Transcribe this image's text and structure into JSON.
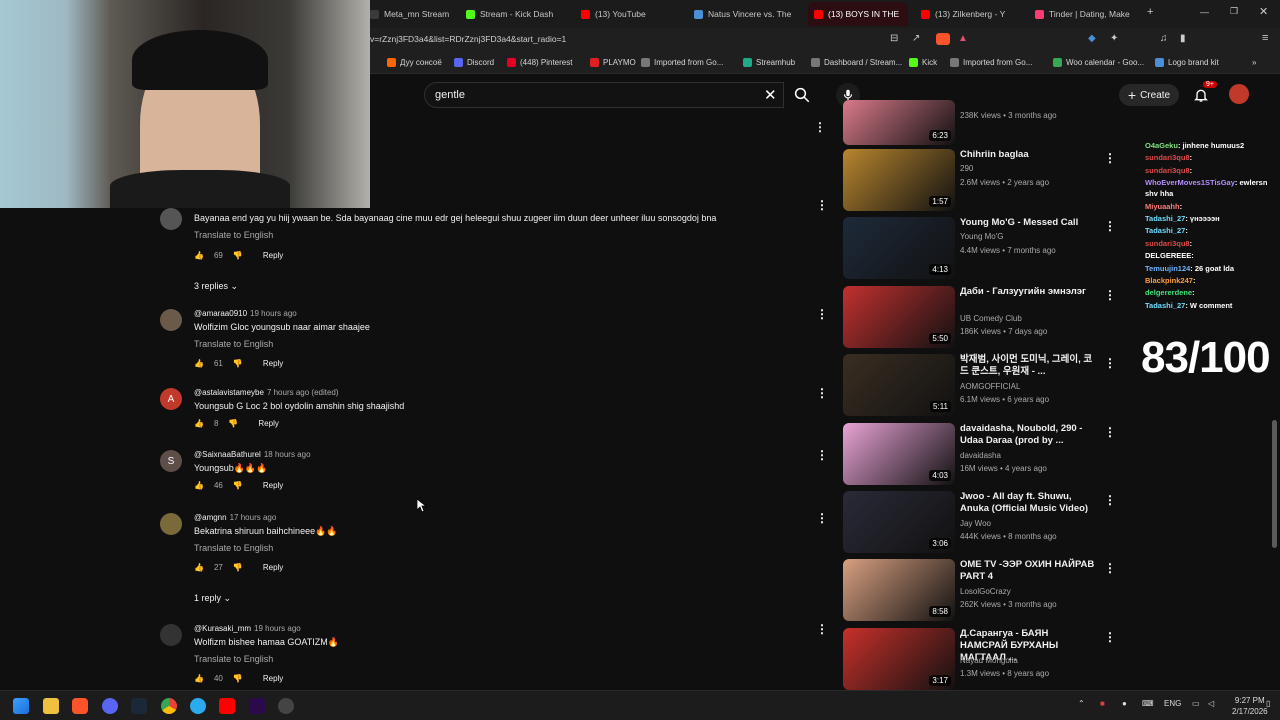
{
  "browser": {
    "tabs": [
      {
        "label": "Meta_mn Stream",
        "color": "#3a3a3a"
      },
      {
        "label": "Stream - Kick Dash",
        "color": "#53fc18"
      },
      {
        "label": "(13) YouTube",
        "color": "#ff0000"
      },
      {
        "label": "Natus Vincere vs. The",
        "color": "#4a8fd8"
      },
      {
        "label": "(13) BOYS IN THE",
        "color": "#ff0000"
      },
      {
        "label": "(13) Zilkenberg - Y",
        "color": "#ff0000"
      },
      {
        "label": "Tinder | Dating, Make",
        "color": "#fe3c72"
      }
    ],
    "url": "v=rZznj3FD3a4&list=RDrZznj3FD3a4&start_radio=1",
    "bookmarks": [
      {
        "label": "Дуу сонсоё",
        "color": "#ff6600"
      },
      {
        "label": "Discord",
        "color": "#5865f2"
      },
      {
        "label": "(448) Pinterest",
        "color": "#e60023"
      },
      {
        "label": "PLAYMO",
        "color": "#e02020"
      },
      {
        "label": "Imported from Go...",
        "color": "#777777"
      },
      {
        "label": "Streamhub",
        "color": "#22aa88"
      },
      {
        "label": "Dashboard / Stream...",
        "color": "#777777"
      },
      {
        "label": "Kick",
        "color": "#53fc18"
      },
      {
        "label": "Imported from Go...",
        "color": "#777777"
      },
      {
        "label": "Woo calendar - Goo...",
        "color": "#34a853"
      },
      {
        "label": "Logo brand kit",
        "color": "#4a8fd8"
      }
    ]
  },
  "youtube": {
    "search_value": "gentle",
    "create_label": "Create",
    "notif_badge": "9+"
  },
  "comments": [
    {
      "author": "",
      "time": "",
      "text": "Bayanaa end yag yu hiij ywaan be. Sda bayanaag cine muu edr gej heleegui shuu zugeer iim duun deer unheer iluu sonsogdoj bna",
      "translate": "Translate to English",
      "likes": "69",
      "reply": "Reply",
      "replies": "3 replies",
      "avatar_color": "#555555",
      "avatar_letter": ""
    },
    {
      "author": "@amaraa0910",
      "time": "19 hours ago",
      "text": "Wolfizim Gloc youngsub naar aimar shaajee",
      "translate": "Translate to English",
      "likes": "61",
      "reply": "Reply",
      "replies": "",
      "avatar_color": "#6b5a4a",
      "avatar_letter": ""
    },
    {
      "author": "@astalavistameybe",
      "time": "7 hours ago (edited)",
      "text": "Youngsub G Loc 2 bol oydolin amshin shig shaajishd",
      "translate": "",
      "likes": "8",
      "reply": "Reply",
      "replies": "",
      "avatar_color": "#c0392b",
      "avatar_letter": "A"
    },
    {
      "author": "@SaixnaaBathurel",
      "time": "18 hours ago",
      "text": "Youngsub🔥🔥🔥",
      "translate": "",
      "likes": "46",
      "reply": "Reply",
      "replies": "",
      "avatar_color": "#5d4e48",
      "avatar_letter": "S"
    },
    {
      "author": "@amgnn",
      "time": "17 hours ago",
      "text": "Bekatrina shiruun baihchineee🔥🔥",
      "translate": "Translate to English",
      "likes": "27",
      "reply": "Reply",
      "replies": "1 reply",
      "avatar_color": "#7a6a3a",
      "avatar_letter": ""
    },
    {
      "author": "@Kurasaki_mm",
      "time": "19 hours ago",
      "text": "Wolfizm bishee hamaa GOATIZM🔥",
      "translate": "Translate to English",
      "likes": "40",
      "reply": "Reply",
      "replies": "",
      "avatar_color": "#333333",
      "avatar_letter": ""
    }
  ],
  "recommendations": [
    {
      "title": "",
      "channel": "",
      "meta": "238K views • 3 months ago",
      "duration": "6:23",
      "thumb": "#d97a8a"
    },
    {
      "title": "Chihriin baglaa",
      "channel": "290",
      "meta": "2.6M views • 2 years ago",
      "duration": "1:57",
      "thumb": "#b8862e"
    },
    {
      "title": "Young Mo'G - Messed Call",
      "channel": "Young Mo'G",
      "meta": "4.4M views • 7 months ago",
      "duration": "4:13",
      "thumb": "#1e2a3a"
    },
    {
      "title": "Даби - Галзуугийн эмнэлэг",
      "channel": "UB Comedy Club",
      "meta": "186K views • 7 days ago",
      "duration": "5:50",
      "thumb": "#c23030"
    },
    {
      "title": "박재범, 사이먼 도미닉, 그레이, 코드 쿤스트, 우원재 - ...",
      "channel": "AOMGOFFICIAL",
      "meta": "6.1M views • 6 years ago",
      "duration": "5:11",
      "thumb": "#3a2e22"
    },
    {
      "title": "davaidasha, Noubold, 290 - Udaa Daraa (prod by ...",
      "channel": "davaidasha",
      "meta": "16M views • 4 years ago",
      "duration": "4:03",
      "thumb": "#e9a3d6"
    },
    {
      "title": "Jwoo - All day ft. Shuwu, Anuka (Official Music Video)",
      "channel": "Jay Woo",
      "meta": "444K views • 8 months ago",
      "duration": "3:06",
      "thumb": "#2a2a38"
    },
    {
      "title": "OME TV -ЭЭР ОХИН НАЙРАВ PART 4",
      "channel": "LosolGoCrazy",
      "meta": "262K views • 3 months ago",
      "duration": "8:58",
      "thumb": "#d8a080"
    },
    {
      "title": "Д.Сарангуа - БАЯН НАМСРАЙ БУРХАНЫ МАГТААЛ ...",
      "channel": "Nayad Mongolia",
      "meta": "1.3M views • 8 years ago",
      "duration": "3:17",
      "thumb": "#c8302a"
    }
  ],
  "chat": [
    {
      "name": "O4aGeku",
      "msg": ": jinhene humuus2",
      "color": "#7fe07f"
    },
    {
      "name": "sundari3qu8",
      "msg": ": ",
      "color": "#e04848"
    },
    {
      "name": "sundari3qu8",
      "msg": ": ",
      "color": "#e04848"
    },
    {
      "name": "WhoEverMoves1STisGay",
      "msg": ": ewlersn",
      "color": "#b58cff"
    },
    {
      "name": "",
      "msg": "shv hha",
      "color": "#ffffff"
    },
    {
      "name": "Miyuaahh",
      "msg": ": ",
      "color": "#ff7a7a"
    },
    {
      "name": "Tadashi_27",
      "msg": ": үнээээн",
      "color": "#6fdcff"
    },
    {
      "name": "Tadashi_27",
      "msg": ": ",
      "color": "#6fdcff"
    },
    {
      "name": "sundari3qu8",
      "msg": ": ",
      "color": "#e04848"
    },
    {
      "name": "DELGEREEE",
      "msg": ": ",
      "color": "#ffffff"
    },
    {
      "name": "Temuujin124",
      "msg": ": 26 goat lda",
      "color": "#6fb4ff"
    },
    {
      "name": "Blackpink247",
      "msg": ": ",
      "color": "#ff9c3a"
    },
    {
      "name": "delgererdene",
      "msg": ": ",
      "color": "#3fe07a"
    },
    {
      "name": "Tadashi_27",
      "msg": ": W comment",
      "color": "#6fdcff"
    }
  ],
  "score": "83/100",
  "taskbar": {
    "lang": "ENG",
    "time": "9:27 PM",
    "date": "2/17/2026"
  }
}
